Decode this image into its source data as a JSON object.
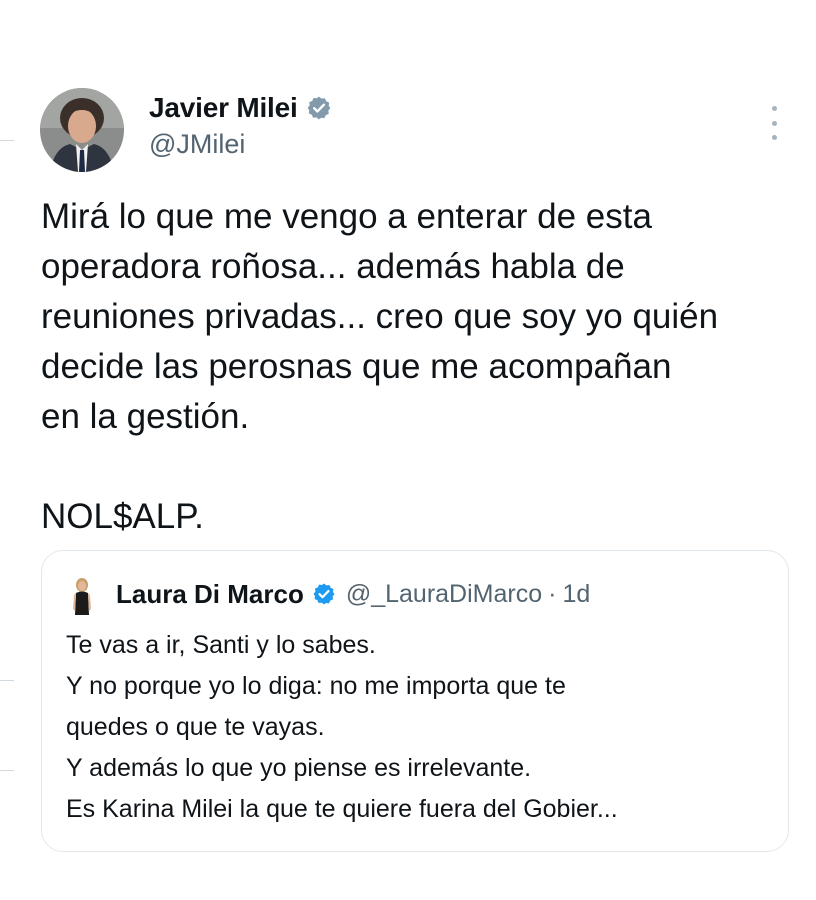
{
  "author": {
    "name": "Javier Milei",
    "handle": "@JMilei",
    "verified_color": "#829aab"
  },
  "more_icon": "more-vertical-icon",
  "tweet": {
    "lines": [
      "Mirá lo que me vengo a enterar de esta",
      "operadora roñosa... además habla de",
      "reuniones privadas... creo que soy yo quién",
      "decide las perosnas que me acompañan",
      "en la gestión.",
      "",
      "NOL$ALP."
    ]
  },
  "quote": {
    "name": "Laura Di Marco",
    "handle": "@_LauraDiMarco",
    "separator": "·",
    "time": "1d",
    "verified_color": "#1d9bf0",
    "lines": [
      "Te vas a ir, Santi y lo sabes.",
      "Y no porque yo lo diga: no me importa que te",
      "quedes o que te vayas.",
      "Y además lo que yo piense es irrelevante.",
      "Es Karina Milei la que te quiere fuera del Gobier..."
    ]
  }
}
